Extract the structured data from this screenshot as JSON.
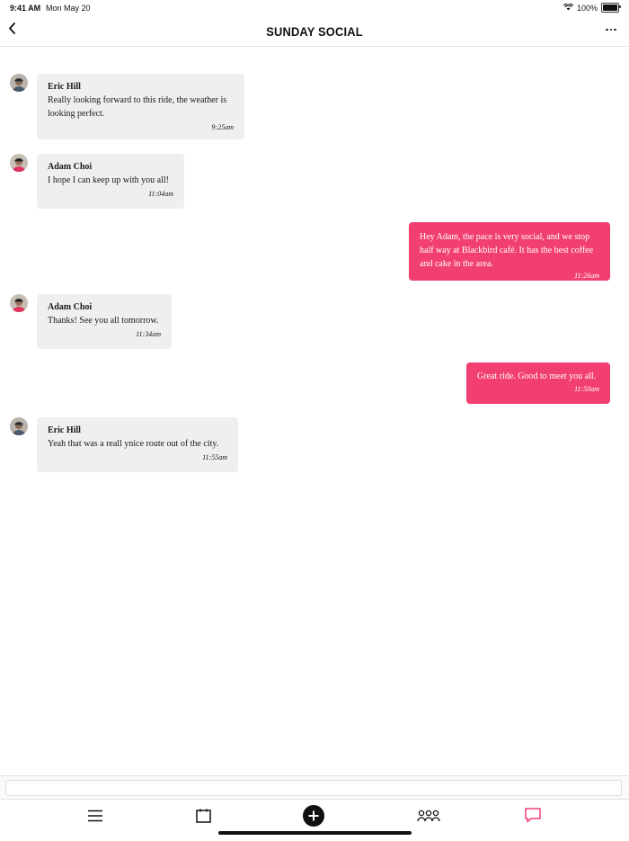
{
  "status_bar": {
    "time": "9:41 AM",
    "date": "Mon May 20",
    "battery": "100%"
  },
  "header": {
    "title": "SUNDAY SOCIAL"
  },
  "messages": [
    {
      "direction": "in",
      "sender": "Eric Hill",
      "text": "Really looking forward to this ride, the weather is looking perfect.",
      "time": "9:25am"
    },
    {
      "direction": "in",
      "sender": "Adam Choi",
      "text": "I hope I can keep up with you all!",
      "time": "11:04am"
    },
    {
      "direction": "out",
      "text": "Hey Adam, the pace is very social, and we stop half way at Blackbird café. It has the best coffee and cake in the area.",
      "time": "11:26am"
    },
    {
      "direction": "in",
      "sender": "Adam Choi",
      "text": "Thanks! See you all tomorrow.",
      "time": "11:34am"
    },
    {
      "direction": "out",
      "text": "Great ride. Good to meet you all.",
      "time": "11:50am"
    },
    {
      "direction": "in",
      "sender": "Eric Hill",
      "text": "Yeah that was a reall ynice route out of the city.",
      "time": "11:55am"
    }
  ],
  "composer": {
    "placeholder": ""
  },
  "tabs": [
    {
      "icon": "menu-icon"
    },
    {
      "icon": "calendar-icon"
    },
    {
      "icon": "add-icon"
    },
    {
      "icon": "people-icon"
    },
    {
      "icon": "chat-icon"
    }
  ],
  "colors": {
    "accent": "#f23f72",
    "incoming_bubble": "#efefef"
  }
}
